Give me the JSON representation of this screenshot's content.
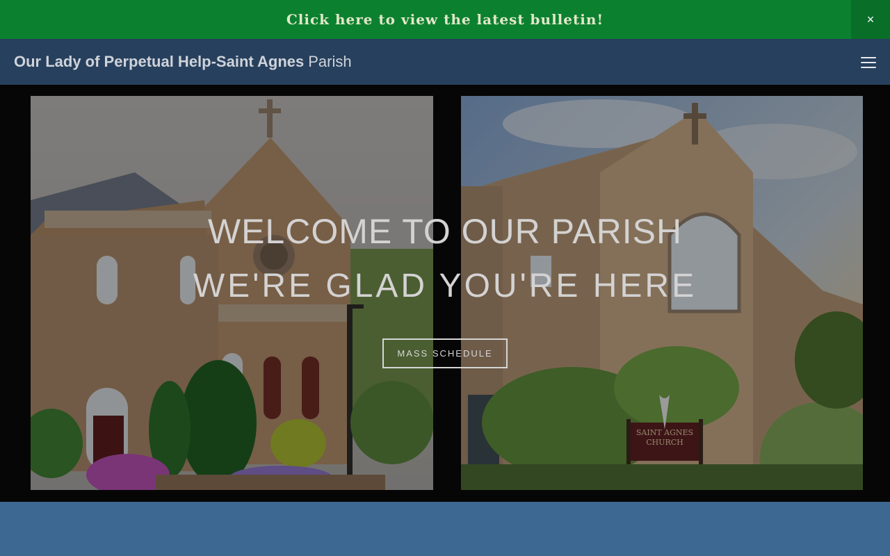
{
  "announcement": {
    "text": "Click here to view the latest bulletin!",
    "close_glyph": "×",
    "background": "#0b8130"
  },
  "header": {
    "title_bold": "Our Lady of Perpetual Help-Saint Agnes",
    "title_light": "Parish",
    "menu_icon": "hamburger-menu-icon",
    "background": "#27405d"
  },
  "hero": {
    "line1": "WELCOME TO OUR PARISH",
    "line2": "WE'RE GLAD YOU'RE HERE",
    "button_label": "MASS SCHEDULE",
    "photos": [
      {
        "name": "our-lady-of-perpetual-help-church-photo"
      },
      {
        "name": "saint-agnes-church-photo"
      }
    ]
  },
  "next_section": {
    "background": "#3d6891"
  }
}
